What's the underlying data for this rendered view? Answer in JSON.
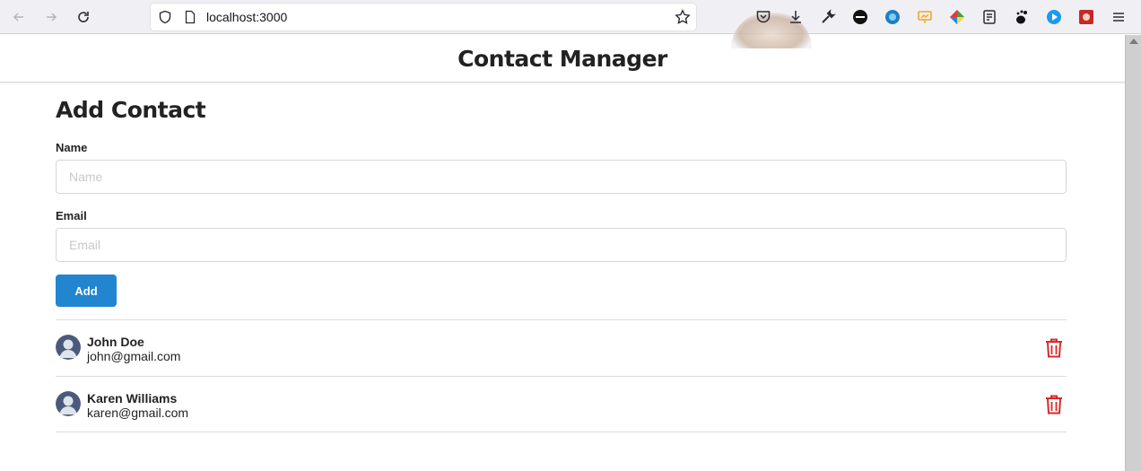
{
  "browser": {
    "url": "localhost:3000"
  },
  "header": {
    "title": "Contact Manager"
  },
  "form": {
    "title": "Add Contact",
    "name_label": "Name",
    "name_placeholder": "Name",
    "name_value": "",
    "email_label": "Email",
    "email_placeholder": "Email",
    "email_value": "",
    "add_label": "Add"
  },
  "contacts": [
    {
      "name": "John Doe",
      "email": "john@gmail.com"
    },
    {
      "name": "Karen Williams",
      "email": "karen@gmail.com"
    }
  ],
  "colors": {
    "primary_button": "#2185d0",
    "delete_icon": "#db2828",
    "avatar": "#4b5a7a"
  },
  "icons": {
    "back": "arrow-left-icon",
    "forward": "arrow-right-icon",
    "reload": "reload-icon",
    "site_info": "shield-icon",
    "page": "page-icon",
    "bookmark": "star-icon",
    "delete": "trash-icon"
  }
}
